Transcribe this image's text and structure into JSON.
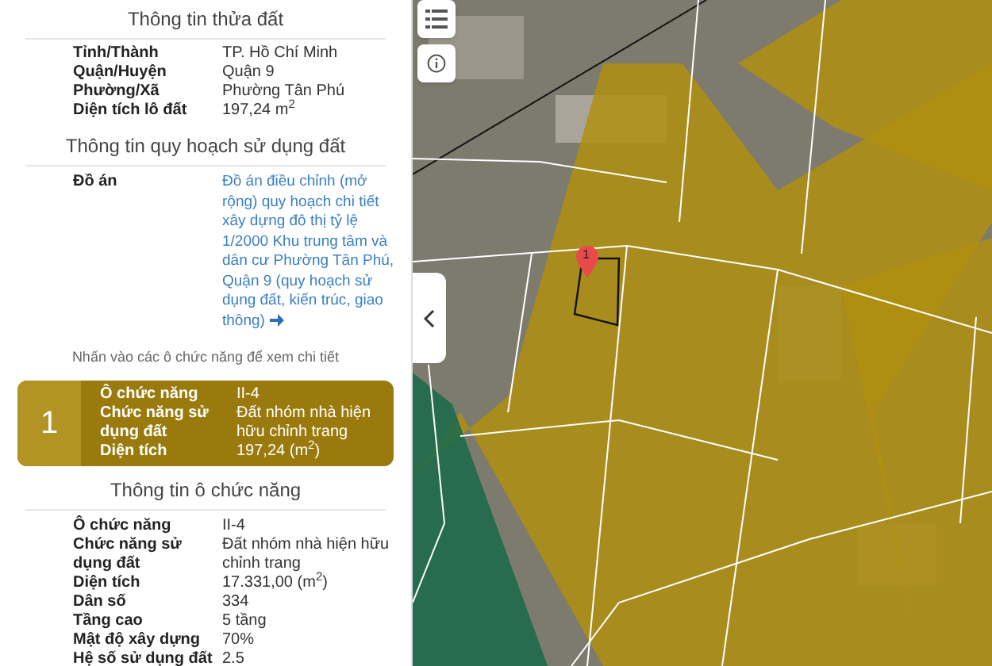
{
  "parcel_info": {
    "title": "Thông tin thửa đất",
    "rows": [
      {
        "label": "Tỉnh/Thành",
        "value": "TP. Hồ Chí Minh"
      },
      {
        "label": "Quận/Huyện",
        "value": "Quận 9"
      },
      {
        "label": "Phường/Xã",
        "value": "Phường Tân Phú"
      },
      {
        "label": "Diện tích lô đất",
        "value": "197,24 m$^{2}$"
      }
    ]
  },
  "planning_info": {
    "title": "Thông tin quy hoạch sử dụng đất",
    "rows": [
      {
        "label": "Đồ án",
        "value": "Đồ án điều chỉnh (mở rộng) quy hoạch chi tiết xây dựng đô thị tỷ lệ 1/2000 Khu trung tâm và dân cư Phường Tân Phú, Quận 9 (quy hoạch sử dụng đất, kiến trúc, giao thông)",
        "kind": "link"
      }
    ],
    "hint": "Nhấn vào các ô chức năng để xem chi tiết"
  },
  "zones": [
    {
      "number": "1",
      "selected": true,
      "rows": [
        {
          "label": "Ô chức năng",
          "value": "II-4"
        },
        {
          "label": "Chức năng sử dụng đất",
          "value": "Đất nhóm nhà hiện hữu chỉnh trang"
        },
        {
          "label": "Diện tích",
          "value": "197,24 (m$^{2}$)"
        }
      ]
    }
  ],
  "zone_info": {
    "title": "Thông tin ô chức năng",
    "rows": [
      {
        "label": "Ô chức năng",
        "value": "II-4"
      },
      {
        "label": "Chức năng sử dụng đất",
        "value": "Đất nhóm nhà hiện hữu chỉnh trang"
      },
      {
        "label": "Diện tích",
        "value": "17.331,00 (m$^{2}$)"
      },
      {
        "label": "Dân số",
        "value": "334"
      },
      {
        "label": "Tầng cao",
        "value": "5 tầng"
      },
      {
        "label": "Mật độ xây dựng",
        "value": "70%"
      },
      {
        "label": "Hệ số sử dụng đất",
        "value": "2.5"
      }
    ]
  },
  "map": {
    "marker_label": "1"
  }
}
